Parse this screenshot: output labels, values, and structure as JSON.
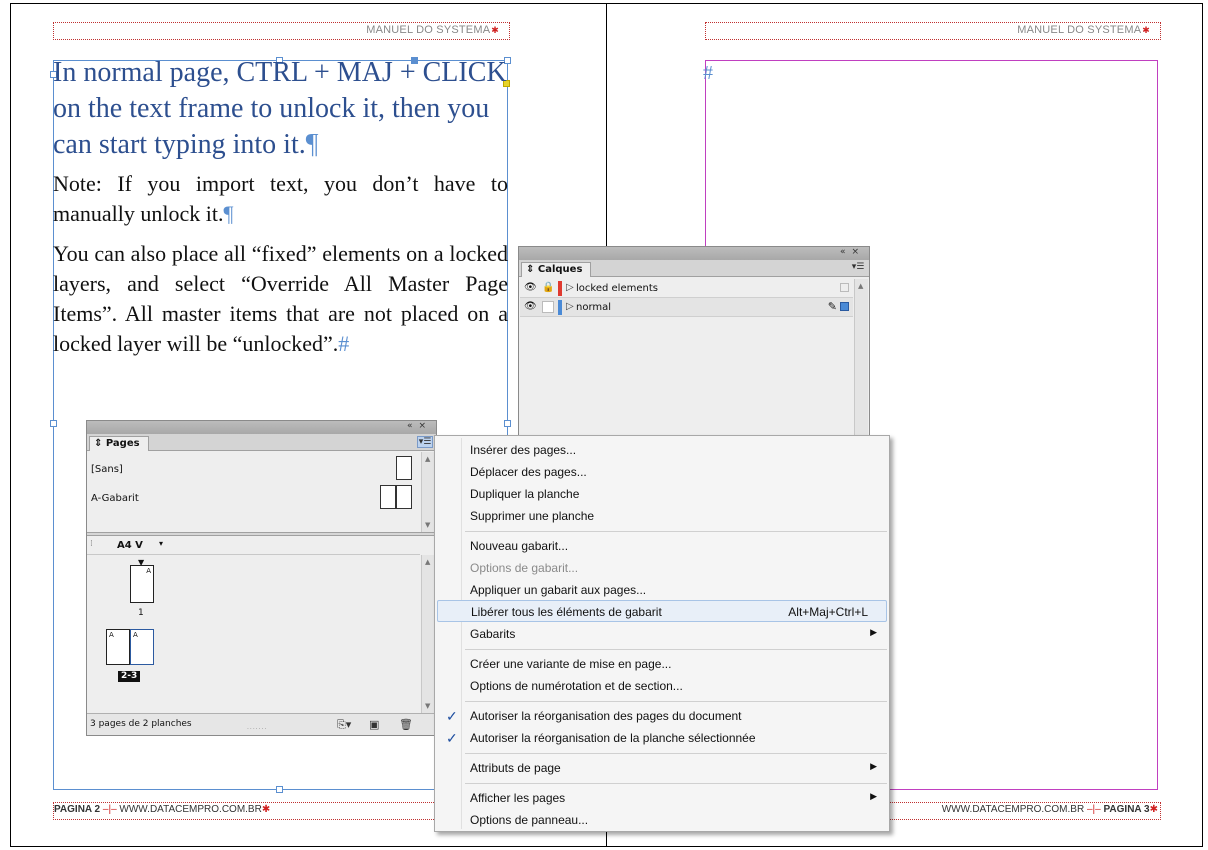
{
  "document": {
    "header_left": "MANUEL DO SYSTEMA",
    "header_right": "MANUEL DO SYSTEMA",
    "header_mark": "✱",
    "footer_left_page": "PAGINA 2",
    "footer_left_url": "WWW.DATACEMPRO.COM.BR",
    "footer_right_url": "WWW.DATACEMPRO.COM.BR",
    "footer_right_page": "PAGINA 3",
    "footer_sep": "–|–",
    "footer_mark": "✱",
    "heading_text": "In normal page, CTRL + MAJ + CLICK on the text frame to unlock it, then you can start typing into it.",
    "pilcrow": "¶",
    "note_text": "Note: If you import text, you don’t have to manually unlock it.",
    "body_text": "You can also place all “fixed” elements on a locked layers, and select “Override All Master Page Items”. All master items that are not placed on a locked layer will be “unlocked”.",
    "end_mark": "#",
    "right_page_mark": "#"
  },
  "calques_panel": {
    "title": "Calques",
    "collapse_icon": "«",
    "close_icon": "×",
    "layers": [
      {
        "name": "locked elements",
        "color": "#e03a2f",
        "locked": true
      },
      {
        "name": "normal",
        "color": "#4a8ad6",
        "locked": false
      }
    ]
  },
  "pages_panel": {
    "title": "Pages",
    "masters": [
      {
        "name": "[Sans]"
      },
      {
        "name": "A-Gabarit"
      }
    ],
    "page_size": "A4 V",
    "page_1_label": "1",
    "page_1_master": "A",
    "spread_label": "2-3",
    "spread_master_left": "A",
    "spread_master_right": "A",
    "status": "3 pages de 2 planches"
  },
  "context_menu": {
    "items": [
      {
        "label": "Insérer des pages..."
      },
      {
        "label": "Déplacer des pages..."
      },
      {
        "label": "Dupliquer la planche"
      },
      {
        "label": "Supprimer une planche"
      },
      {
        "label": "Nouveau gabarit..."
      },
      {
        "label": "Options de gabarit...",
        "disabled": true
      },
      {
        "label": "Appliquer un gabarit aux pages..."
      },
      {
        "label": "Libérer tous les éléments de gabarit",
        "shortcut": "Alt+Maj+Ctrl+L",
        "highlighted": true
      },
      {
        "label": "Gabarits",
        "submenu": true
      },
      {
        "label": "Créer une variante de mise en page..."
      },
      {
        "label": "Options de numérotation et de section..."
      },
      {
        "label": "Autoriser la réorganisation des pages du document",
        "checked": true
      },
      {
        "label": "Autoriser la réorganisation de la planche sélectionnée",
        "checked": true
      },
      {
        "label": "Attributs de page",
        "submenu": true
      },
      {
        "label": "Afficher les pages",
        "submenu": true
      },
      {
        "label": "Options de panneau..."
      }
    ]
  }
}
